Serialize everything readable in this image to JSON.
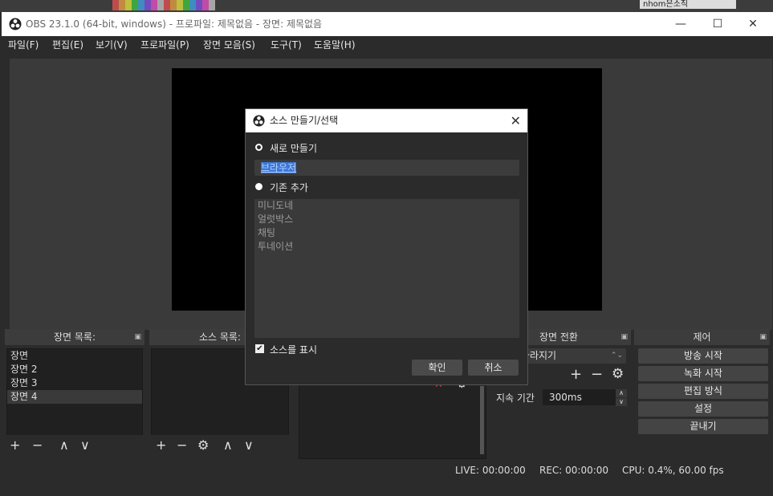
{
  "window": {
    "title": "OBS 23.1.0 (64-bit, windows) - 프로파일: 제목없음 - 장면: 제목없음"
  },
  "window_controls": {
    "minimize": "—",
    "maximize": "☐",
    "close": "✕"
  },
  "menu": [
    "파일(F)",
    "편집(E)",
    "보기(V)",
    "프로파일(P)",
    "장면 모음(S)",
    "도구(T)",
    "도움말(H)"
  ],
  "docks": {
    "scenes": {
      "title": "장면 목록:",
      "items": [
        "장면",
        "장면 2",
        "장면 3",
        "장면 4"
      ],
      "selected_index": 3
    },
    "sources": {
      "title": "소스 목록:"
    },
    "transitions": {
      "title": "장면 전환",
      "type_value": "페이드 사라지기",
      "duration_label": "지속 기간",
      "duration_value": "300ms"
    },
    "controls": {
      "title": "제어",
      "buttons": [
        "방송 시작",
        "녹화 시작",
        "편집 방식",
        "설정",
        "끝내기"
      ]
    }
  },
  "toolbar_icons": {
    "add": "+",
    "remove": "−",
    "settings": "⚙",
    "up": "∧",
    "down": "∨",
    "float": "▣"
  },
  "status": {
    "live": "LIVE: 00:00:00",
    "rec": "REC: 00:00:00",
    "cpu": "CPU: 0.4%, 60.00 fps"
  },
  "dialog": {
    "title": "소스 만들기/선택",
    "close": "✕",
    "create_new_label": "새로 만들기",
    "create_new_selected": true,
    "name_value": "브라우저",
    "add_existing_label": "기존 추가",
    "existing_sources": [
      "미니도네",
      "얼럿박스",
      "채팅",
      "투네이션"
    ],
    "show_source_label": "소스를 표시",
    "show_source_checked": true,
    "ok_label": "확인",
    "cancel_label": "취소"
  },
  "background": {
    "font_box": "nhom은소직"
  }
}
